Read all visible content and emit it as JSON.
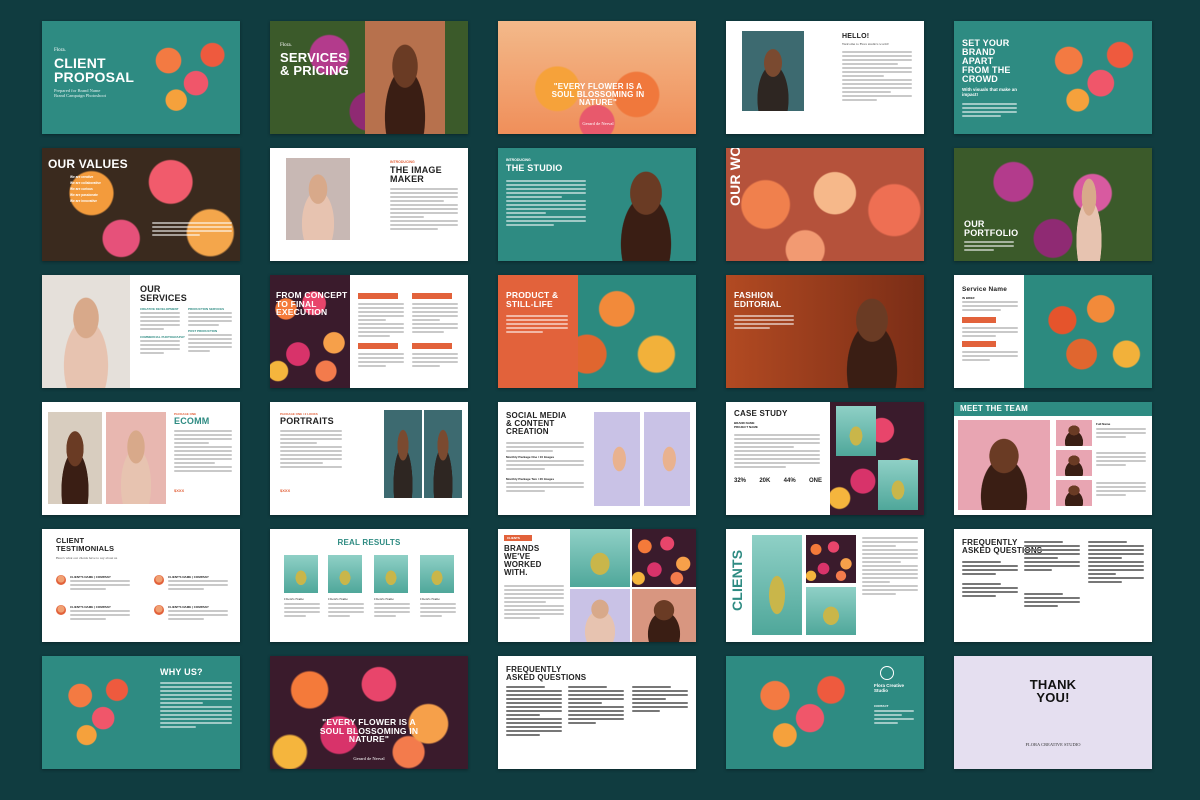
{
  "row1": {
    "s1": {
      "pre": "Flora.",
      "title1": "Client",
      "title2": "Proposal",
      "sub": "Prepared for Brand Name",
      "sub2": "Brand Campaign Photoshoot"
    },
    "s2": {
      "pre": "Flora.",
      "title1": "Services",
      "title2": "& Pricing"
    },
    "s3": {
      "quote": "\"Every flower is a soul blossoming in nature\"",
      "author": "Gerard de Nerval"
    },
    "s4": {
      "greeting": "Hello!",
      "intro": "Welcome to Flora studio's world!"
    },
    "s5": {
      "title": "Set your brand apart from the crowd",
      "sub": "With visuals that make an impact!"
    }
  },
  "row2": {
    "s1": {
      "title": "Our Values",
      "items": [
        "We are creative",
        "We are collaborative",
        "We are curious",
        "We are passionate",
        "We are innovative"
      ]
    },
    "s2": {
      "pre": "Introducing",
      "title1": "The Image",
      "title2": "Maker"
    },
    "s3": {
      "pre": "Introducing",
      "title": "The Studio"
    },
    "s4": {
      "title1": "Our",
      "title2": "Work"
    },
    "s5": {
      "title1": "Our",
      "title2": "Portfolio"
    }
  },
  "row3": {
    "s1": {
      "title1": "Our",
      "title2": "Services",
      "c1": "Creative Development",
      "c2": "Production Services",
      "c3": "Post Production",
      "c4": "Commercial Photography"
    },
    "s2": {
      "title": "From concept to final execution"
    },
    "s3": {
      "title1": "Product &",
      "title2": "Still-Life"
    },
    "s4": {
      "title1": "Fashion",
      "title2": "Editorial"
    },
    "s5": {
      "title": "Service Name",
      "label": "In Brief"
    }
  },
  "row4": {
    "s1": {
      "pre": "Package One",
      "title": "Ecomm",
      "price": "$XXX"
    },
    "s2": {
      "pre": "Package One / 2 Looks",
      "title": "Portraits",
      "price": "$XXX"
    },
    "s3": {
      "title1": "Social Media",
      "title2": "& Content",
      "title3": "Creation",
      "pkg1": "Monthly Package One / 10 Images",
      "pkg2": "Monthly Package Two / 20 Images"
    },
    "s4": {
      "title": "Case Study",
      "brand": "Brand Name",
      "project": "Project Name",
      "stats": [
        "32%",
        "20K",
        "44%",
        "ONE"
      ]
    },
    "s5": {
      "title": "Meet the Team",
      "member": "Role",
      "name": "Full Name"
    }
  },
  "row5": {
    "s1": {
      "title1": "Client",
      "title2": "Testimonials",
      "sub": "Here's what our clients have to say about us",
      "client": "Client's Name | Company"
    },
    "s2": {
      "title": "Real Results",
      "client": "Client's Name"
    },
    "s3": {
      "tag": "Clients",
      "title": "Brands we've worked with."
    },
    "s4": {
      "title": "Clients"
    },
    "s5": {
      "title1": "Frequently",
      "title2": "Asked Questions"
    }
  },
  "row6": {
    "s1": {
      "title": "Why us?"
    },
    "s2": {
      "quote": "\"Every flower is a soul blossoming in nature\"",
      "author": "Gerard de Nerval"
    },
    "s3": {
      "title1": "Frequently",
      "title2": "Asked Questions"
    },
    "s4": {
      "brand": "Flora Creative Studio",
      "contact": "Contact"
    },
    "s5": {
      "title1": "Thank",
      "title2": "You!",
      "brand": "Flora Creative Studio"
    }
  },
  "colors": {
    "background": "#103c40",
    "teal": "#2e8b82",
    "accent": "#e2623b",
    "lavender": "#e5dff0"
  }
}
